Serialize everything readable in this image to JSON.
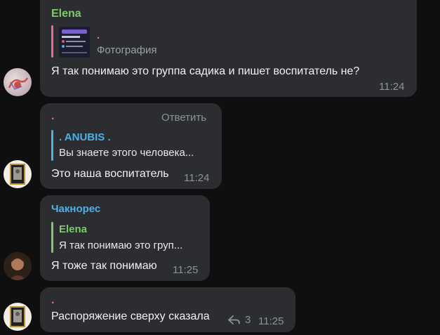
{
  "colors": {
    "background": "#0f0f10",
    "bubble": "#2b2d31",
    "elena": "#7ec96a",
    "pink": "#e66a9e",
    "blue": "#4fb0e6",
    "time": "#8e9299"
  },
  "messages": [
    {
      "sender": "Elena",
      "reply": {
        "name": ".",
        "text": "Фотография"
      },
      "text": "Я так понимаю это группа садика и пишет воспитатель не?",
      "time": "11:24"
    },
    {
      "sender": ".",
      "action": "Ответить",
      "reply": {
        "name": ". ANUBIS .",
        "text": "Вы знаете этого человека..."
      },
      "text": "Это наша воспитатель",
      "time": "11:24"
    },
    {
      "sender": "Чакнорес",
      "reply": {
        "name": "Elena",
        "text": "Я так понимаю это груп..."
      },
      "text": "Я тоже так понимаю",
      "time": "11:25"
    },
    {
      "sender": ".",
      "text": "Распоряжение сверху сказала",
      "replies_count": "3",
      "time": "11:25",
      "icon": "reply-arrow-icon"
    }
  ]
}
